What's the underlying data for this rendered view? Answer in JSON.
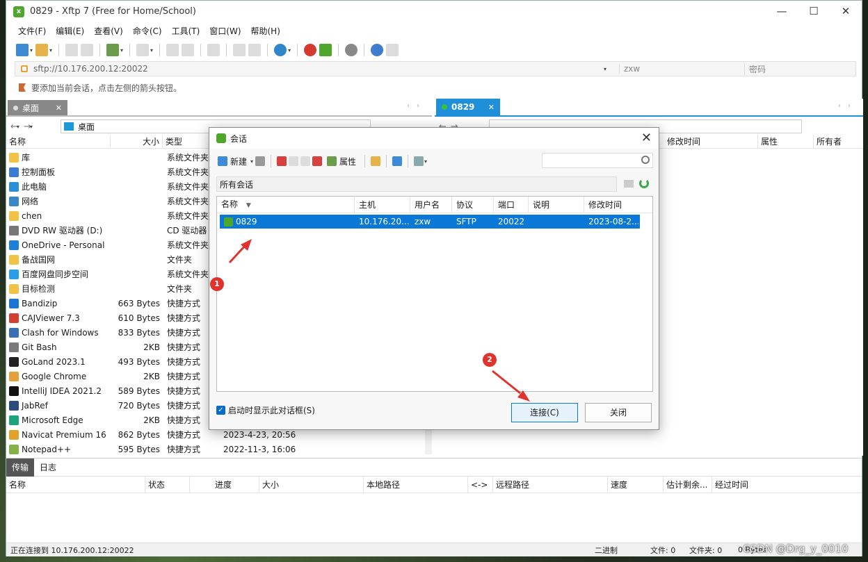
{
  "window": {
    "title": "0829 - Xftp 7 (Free for Home/School)",
    "minimize": "—",
    "maximize": "☐",
    "close": "✕"
  },
  "menu": [
    "文件(F)",
    "编辑(E)",
    "查看(V)",
    "命令(C)",
    "工具(T)",
    "窗口(W)",
    "帮助(H)"
  ],
  "address": {
    "url": "sftp://10.176.200.12:20022",
    "user": "zxw",
    "password_placeholder": "密码"
  },
  "hint": "要添加当前会话，点击左侧的箭头按钮。",
  "left_panel": {
    "tab": "桌面",
    "path": "桌面",
    "columns": [
      "名称",
      "大小",
      "类型"
    ],
    "files": [
      {
        "name": "库",
        "size": "",
        "type": "系统文件夹",
        "icon": "#f2c246"
      },
      {
        "name": "控制面板",
        "size": "",
        "type": "系统文件夹",
        "icon": "#3a7bd5"
      },
      {
        "name": "此电脑",
        "size": "",
        "type": "系统文件夹",
        "icon": "#2a8fd8"
      },
      {
        "name": "网络",
        "size": "",
        "type": "系统文件夹",
        "icon": "#3a87c8"
      },
      {
        "name": "chen",
        "size": "",
        "type": "系统文件夹",
        "icon": "#f2c246"
      },
      {
        "name": "DVD RW 驱动器 (D:)",
        "size": "",
        "type": "CD 驱动器",
        "icon": "#777"
      },
      {
        "name": "OneDrive - Personal",
        "size": "",
        "type": "系统文件夹",
        "icon": "#1e7fd8"
      },
      {
        "name": "备战国网",
        "size": "",
        "type": "文件夹",
        "icon": "#f2c246"
      },
      {
        "name": "百度网盘同步空间",
        "size": "",
        "type": "系统文件夹",
        "icon": "#2a9de8"
      },
      {
        "name": "目标检测",
        "size": "",
        "type": "文件夹",
        "icon": "#f2c246"
      },
      {
        "name": "Bandizip",
        "size": "663 Bytes",
        "type": "快捷方式",
        "icon": "#1d74d6"
      },
      {
        "name": "CAJViewer 7.3",
        "size": "610 Bytes",
        "type": "快捷方式",
        "icon": "#d4402f"
      },
      {
        "name": "Clash for Windows",
        "size": "833 Bytes",
        "type": "快捷方式",
        "icon": "#3a6fb5"
      },
      {
        "name": "Git Bash",
        "size": "2KB",
        "type": "快捷方式",
        "icon": "#7a7a7a"
      },
      {
        "name": "GoLand 2023.1",
        "size": "493 Bytes",
        "type": "快捷方式",
        "icon": "#222"
      },
      {
        "name": "Google Chrome",
        "size": "2KB",
        "type": "快捷方式",
        "icon": "#e2a13a"
      },
      {
        "name": "IntelliJ IDEA 2021.2",
        "size": "589 Bytes",
        "type": "快捷方式",
        "icon": "#111"
      },
      {
        "name": "JabRef",
        "size": "720 Bytes",
        "type": "快捷方式",
        "icon": "#2c4a80"
      },
      {
        "name": "Microsoft Edge",
        "size": "2KB",
        "type": "快捷方式",
        "icon": "#1fa37f"
      },
      {
        "name": "Navicat Premium 16",
        "size": "862 Bytes",
        "type": "快捷方式",
        "icon": "#e0a22a"
      },
      {
        "name": "Notepad++",
        "size": "595 Bytes",
        "type": "快捷方式",
        "icon": "#86b04a"
      }
    ],
    "visible_dates": [
      "2023-4-23, 20:56",
      "2022-11-3, 16:06"
    ]
  },
  "right_panel": {
    "tab": "0829",
    "columns": [
      "修改时间",
      "属性",
      "所有者"
    ]
  },
  "transfer": {
    "tabs": [
      "传输",
      "日志"
    ],
    "columns": [
      "名称",
      "状态",
      "进度",
      "大小",
      "本地路径",
      "<->",
      "远程路径",
      "速度",
      "估计剩余...",
      "经过时间"
    ]
  },
  "status": {
    "left": "正在连接到 10.176.200.12:20022",
    "mode": "二进制",
    "files": "文件: 0",
    "folders": "文件夹: 0",
    "bytes": "0 Bytes"
  },
  "dialog": {
    "title": "会话",
    "close": "✕",
    "new_label": "新建",
    "props_label": "属性",
    "folder": "所有会话",
    "columns": [
      "名称",
      "主机",
      "用户名",
      "协议",
      "端口",
      "说明",
      "修改时间"
    ],
    "session": {
      "name": "0829",
      "host": "10.176.20...",
      "user": "zxw",
      "protocol": "SFTP",
      "port": "20022",
      "desc": "",
      "modified": "2023-08-2..."
    },
    "checkbox_label": "启动时显示此对话框(S)",
    "connect_label": "连接(C)",
    "close_label": "关闭"
  },
  "annotations": {
    "badge1": "1",
    "badge2": "2"
  },
  "watermark": "CSDN @Drg_y_0010"
}
